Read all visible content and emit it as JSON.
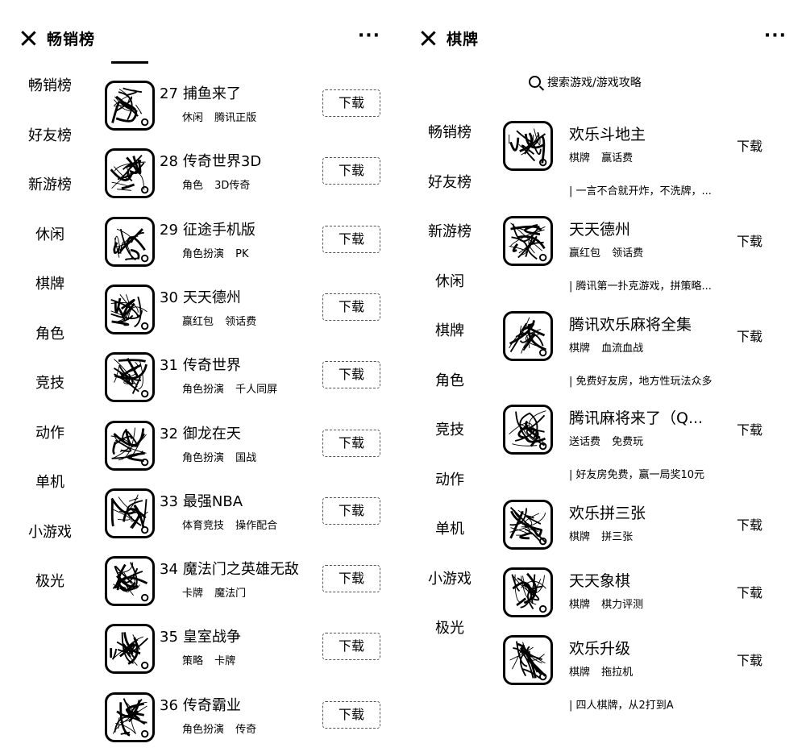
{
  "left_panel": {
    "title": "畅销榜",
    "more": "···",
    "sidebar": [
      "畅销榜",
      "好友榜",
      "新游榜",
      "休闲",
      "棋牌",
      "角色",
      "竞技",
      "动作",
      "单机",
      "小游戏",
      "极光"
    ],
    "download_label": "下载",
    "games": [
      {
        "rank": "27",
        "name": "捕鱼来了",
        "tags": "休闲 腾讯正版",
        "icon": "fishing-game-icon"
      },
      {
        "rank": "28",
        "name": "传奇世界3D",
        "tags": "角色 3D传奇",
        "icon": "legend-world-3d-icon"
      },
      {
        "rank": "29",
        "name": "征途手机版",
        "tags": "角色扮演 PK",
        "icon": "zhengtu-icon"
      },
      {
        "rank": "30",
        "name": "天天德州",
        "tags": "赢红包 领话费",
        "icon": "texas-poker-icon"
      },
      {
        "rank": "31",
        "name": "传奇世界",
        "tags": "角色扮演 千人同屏",
        "icon": "legend-world-icon"
      },
      {
        "rank": "32",
        "name": "御龙在天",
        "tags": "角色扮演 国战",
        "icon": "yulong-icon"
      },
      {
        "rank": "33",
        "name": "最强NBA",
        "tags": "体育竞技 操作配合",
        "icon": "nba-icon"
      },
      {
        "rank": "34",
        "name": "魔法门之英雄无敌",
        "tags": "卡牌 魔法门",
        "icon": "heroes-magic-icon"
      },
      {
        "rank": "35",
        "name": "皇室战争",
        "tags": "策略 卡牌",
        "icon": "clash-royale-icon"
      },
      {
        "rank": "36",
        "name": "传奇霸业",
        "tags": "角色扮演 传奇",
        "icon": "legend-baye-icon"
      }
    ]
  },
  "right_panel": {
    "title": "棋牌",
    "more": "···",
    "search_placeholder": "搜索游戏/游戏攻略",
    "sidebar": [
      "畅销榜",
      "好友榜",
      "新游榜",
      "休闲",
      "棋牌",
      "角色",
      "竞技",
      "动作",
      "单机",
      "小游戏",
      "极光"
    ],
    "download_label": "下载",
    "games": [
      {
        "name": "欢乐斗地主",
        "tags": "棋牌 赢话费",
        "desc": "| 一言不合就开炸，不洗牌，...",
        "icon": "doudizhu-icon"
      },
      {
        "name": "天天德州",
        "tags": "赢红包 领话费",
        "desc": "| 腾讯第一扑克游戏，拼策略...",
        "icon": "texas-poker-icon"
      },
      {
        "name": "腾讯欢乐麻将全集",
        "tags": "棋牌 血流血战",
        "desc": "| 免费好友房，地方性玩法众多",
        "icon": "mahjong-icon"
      },
      {
        "name": "腾讯麻将来了（Q...",
        "tags": "送话费 免费玩",
        "desc": "| 好友房免费，赢一局奖10元",
        "icon": "mahjong-hu-icon"
      },
      {
        "name": "欢乐拼三张",
        "tags": "棋牌 拼三张",
        "desc": "",
        "icon": "pinsanzhang-icon"
      },
      {
        "name": "天天象棋",
        "tags": "棋牌 棋力评测",
        "desc": "",
        "icon": "chess-icon"
      },
      {
        "name": "欢乐升级",
        "tags": "棋牌 拖拉机",
        "desc": "| 四人棋牌，从2打到A",
        "icon": "shengji-icon"
      }
    ]
  }
}
